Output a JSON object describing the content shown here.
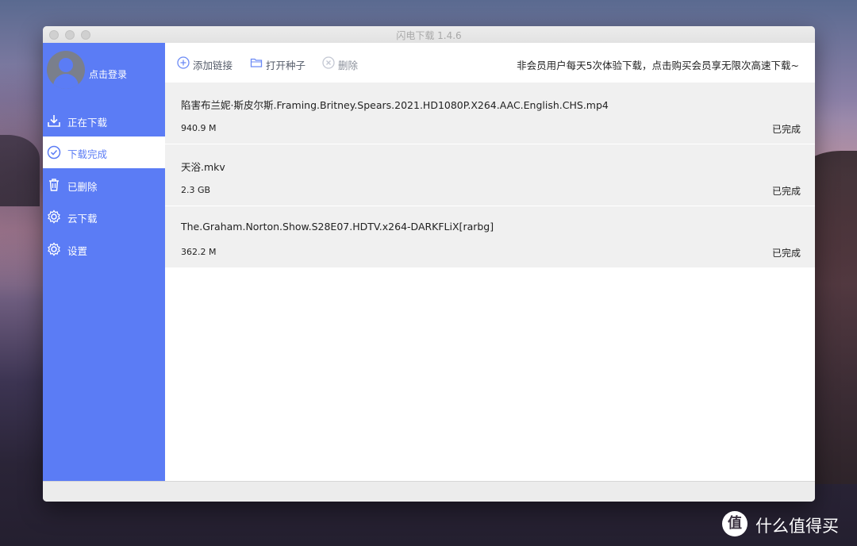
{
  "window": {
    "title": "闪电下载 1.4.6"
  },
  "user": {
    "login_label": "点击登录"
  },
  "sidebar": {
    "items": [
      {
        "label": "正在下载",
        "icon": "download-icon"
      },
      {
        "label": "下载完成",
        "icon": "check-circle-icon",
        "active": true
      },
      {
        "label": "已删除",
        "icon": "trash-icon"
      },
      {
        "label": "云下载",
        "icon": "gear-icon"
      },
      {
        "label": "设置",
        "icon": "gear-icon"
      }
    ]
  },
  "toolbar": {
    "add_link_label": "添加链接",
    "open_torrent_label": "打开种子",
    "delete_label": "删除",
    "promo_text": "非会员用户每天5次体验下载，点击购买会员享无限次高速下载~"
  },
  "downloads": [
    {
      "name": "陷害布兰妮·斯皮尔斯.Framing.Britney.Spears.2021.HD1080P.X264.AAC.English.CHS.mp4",
      "size": "940.9 M",
      "status": "已完成"
    },
    {
      "name": "天浴.mkv",
      "size": "2.3 GB",
      "status": "已完成"
    },
    {
      "name": "The.Graham.Norton.Show.S28E07.HDTV.x264-DARKFLiX[rarbg]",
      "size": "362.2 M",
      "status": "已完成"
    }
  ],
  "watermark": {
    "logo": "值",
    "text": "什么值得买"
  },
  "colors": {
    "accent": "#5b7cf5",
    "row_bg": "#f0f0f0"
  }
}
